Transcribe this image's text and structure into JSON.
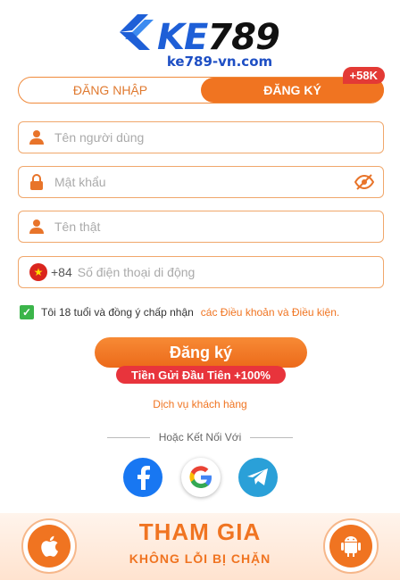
{
  "brand": {
    "name_prefix": "KE",
    "name_number": "789",
    "domain": "ke789-vn.com",
    "primary_color": "#1e5fd7",
    "accent_color": "#f07421"
  },
  "tabs": {
    "login_label": "ĐĂNG NHẬP",
    "register_label": "ĐĂNG KÝ",
    "badge": "+58K",
    "active": "register"
  },
  "form": {
    "username_placeholder": "Tên người dùng",
    "password_placeholder": "Mật khẩu",
    "realname_placeholder": "Tên thật",
    "country_code": "+84",
    "phone_placeholder": "Số điện thoại di động"
  },
  "terms": {
    "text": "Tôi 18 tuổi và đồng ý chấp nhận",
    "link": "các Điều khoản và Điều kiện.",
    "checked": true
  },
  "register_button": {
    "label": "Đăng ký",
    "promo": "Tiền Gửi Đầu Tiên +100%"
  },
  "service_link": "Dịch vụ khách hàng",
  "social": {
    "divider_text": "Hoặc Kết Nối Với",
    "providers": [
      "facebook-icon",
      "google-icon",
      "telegram-icon"
    ]
  },
  "banner": {
    "title": "THAM GIA",
    "subtitle": "KHÔNG LỖI BỊ CHẶN"
  }
}
